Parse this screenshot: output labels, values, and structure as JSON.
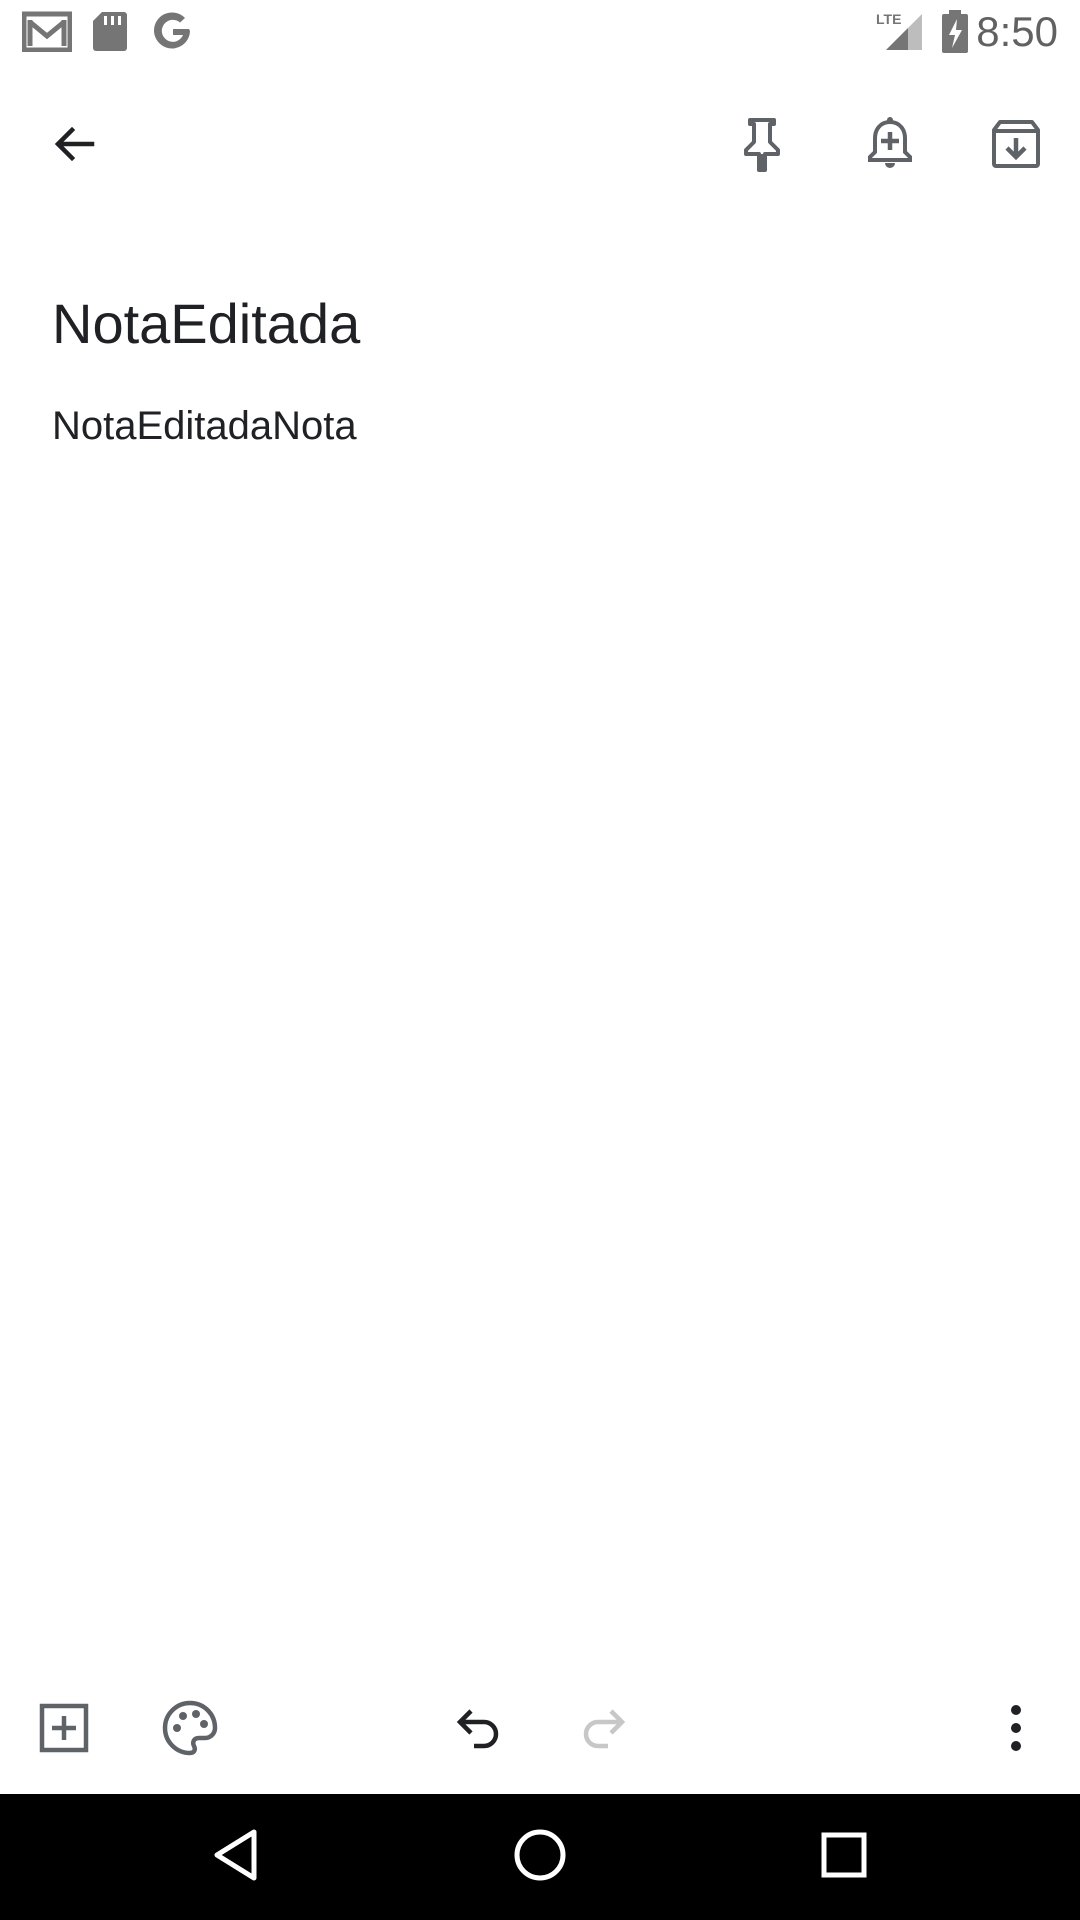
{
  "status_bar": {
    "time": "8:50",
    "network": "LTE",
    "left_icons": [
      "gmail-icon",
      "sd-card-icon",
      "google-icon"
    ],
    "right_icons": [
      "signal-icon",
      "battery-charging-icon"
    ]
  },
  "toolbar": {
    "back": "back-arrow-icon",
    "actions": [
      "pin-icon",
      "reminder-icon",
      "archive-icon"
    ]
  },
  "note": {
    "title": "NotaEditada",
    "body": "NotaEditadaNota"
  },
  "bottom_bar": {
    "left_actions": [
      "add-box-icon",
      "palette-icon"
    ],
    "center_actions": [
      "undo-icon",
      "redo-icon"
    ],
    "right_actions": [
      "more-vert-icon"
    ]
  },
  "nav_bar": {
    "buttons": [
      "back-triangle-icon",
      "home-circle-icon",
      "recents-square-icon"
    ]
  },
  "colors": {
    "background": "#ffffff",
    "text": "#202124",
    "icon": "#5f6368",
    "disabled_icon": "#c7c7c7",
    "nav_background": "#000000"
  }
}
